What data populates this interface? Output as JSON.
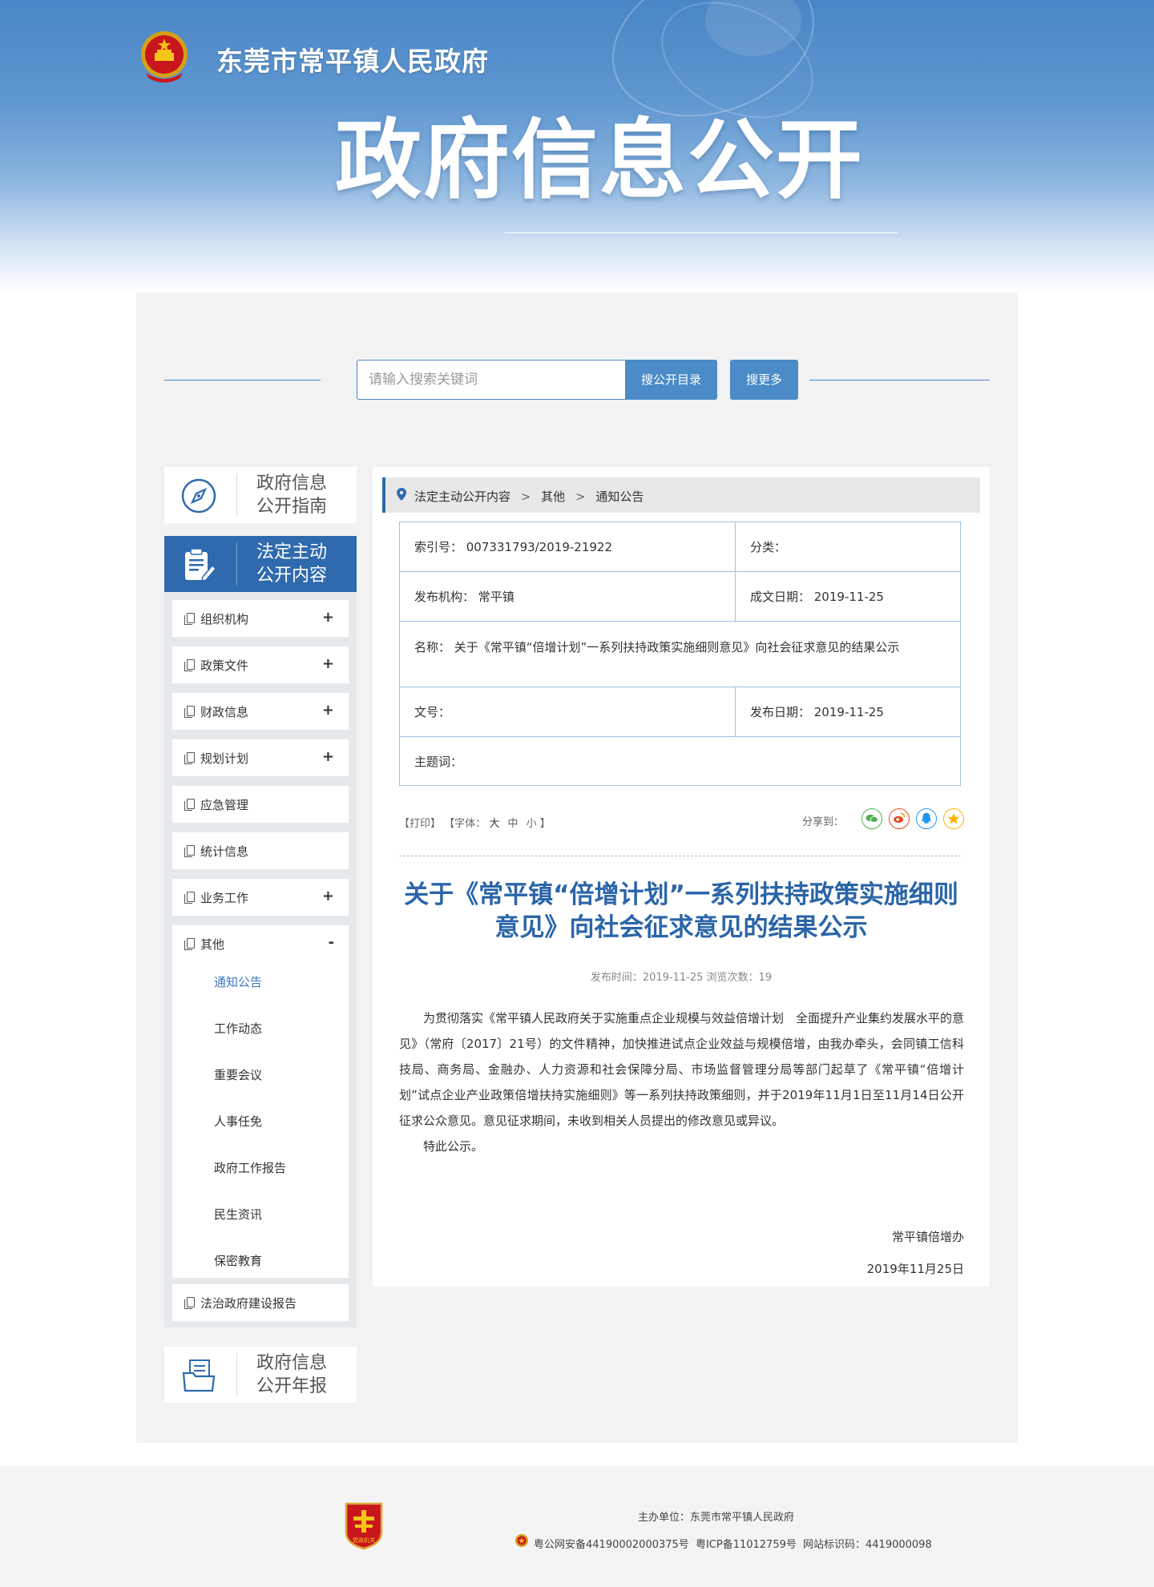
{
  "header": {
    "site_name": "东莞市常平镇人民政府",
    "big_title": "政府信息公开"
  },
  "search": {
    "placeholder": "请输入搜索关键词",
    "button_catalog": "搜公开目录",
    "button_more": "搜更多"
  },
  "sidebar": {
    "guide": "政府信息\n公开指南",
    "statutory": "法定主动\n公开内容",
    "annual": "政府信息\n公开年报",
    "items": [
      {
        "label": "组织机构",
        "toggle": "+"
      },
      {
        "label": "政策文件",
        "toggle": "+"
      },
      {
        "label": "财政信息",
        "toggle": "+"
      },
      {
        "label": "规划计划",
        "toggle": "+"
      },
      {
        "label": "应急管理",
        "toggle": ""
      },
      {
        "label": "统计信息",
        "toggle": ""
      },
      {
        "label": "业务工作",
        "toggle": "+"
      },
      {
        "label": "其他",
        "toggle": "-"
      }
    ],
    "other_children": [
      "通知公告",
      "工作动态",
      "重要会议",
      "人事任免",
      "政府工作报告",
      "民生资讯",
      "保密教育"
    ],
    "last_item": "法治政府建设报告"
  },
  "breadcrumb": {
    "level1": "法定主动公开内容",
    "level2": "其他",
    "level3": "通知公告",
    "separator": ">"
  },
  "meta": {
    "index_no": "索引号： 007331793/2019-21922",
    "category": "分类：",
    "publisher": "发布机构： 常平镇",
    "written_date": "成文日期： 2019-11-25",
    "name": "名称： 关于《常平镇“倍增计划”一系列扶持政策实施细则意见》向社会征求意见的结果公示",
    "doc_no": "文号：",
    "publish_date": "发布日期： 2019-11-25",
    "keywords": "主题词："
  },
  "tools": {
    "print": "【打印】",
    "font": "【字体：",
    "font_large": "大",
    "font_medium": "中",
    "font_small": "小",
    "font_close": "】",
    "share_label": "分享到："
  },
  "article": {
    "title": "关于《常平镇“倍增计划”一系列扶持政策实施细则意见》向社会征求意见的结果公示",
    "info": "发布时间：2019-11-25   浏览次数：19",
    "paragraph1": "为贯彻落实《常平镇人民政府关于实施重点企业规模与效益倍增计划　全面提升产业集约发展水平的意见》（常府〔2017〕21号）的文件精神，加快推进试点企业效益与规模倍增，由我办牵头，会同镇工信科技局、商务局、金融办、人力资源和社会保障分局、市场监督管理分局等部门起草了《常平镇“倍增计划”试点企业产业政策倍增扶持实施细则》等一系列扶持政策细则，并于2019年11月1日至11月14日公开征求公众意见。意见征求期间，未收到相关人员提出的修改意见或异议。",
    "paragraph2": "特此公示。",
    "signer": "常平镇倍增办",
    "sign_date": "2019年11月25日"
  },
  "footer": {
    "sponsor": "主办单位：东莞市常平镇人民政府",
    "police_record": "粤公网安备44190002000375号",
    "icp": "粤ICP备11012759号",
    "site_code": "网站标识码：4419000098",
    "party_logo": "党政机关"
  },
  "colors": {
    "brand_blue": "#2e6aad",
    "button_blue": "#4a8bc8",
    "title_blue": "#2b65a8",
    "panel_grey": "#f2f2f2"
  }
}
